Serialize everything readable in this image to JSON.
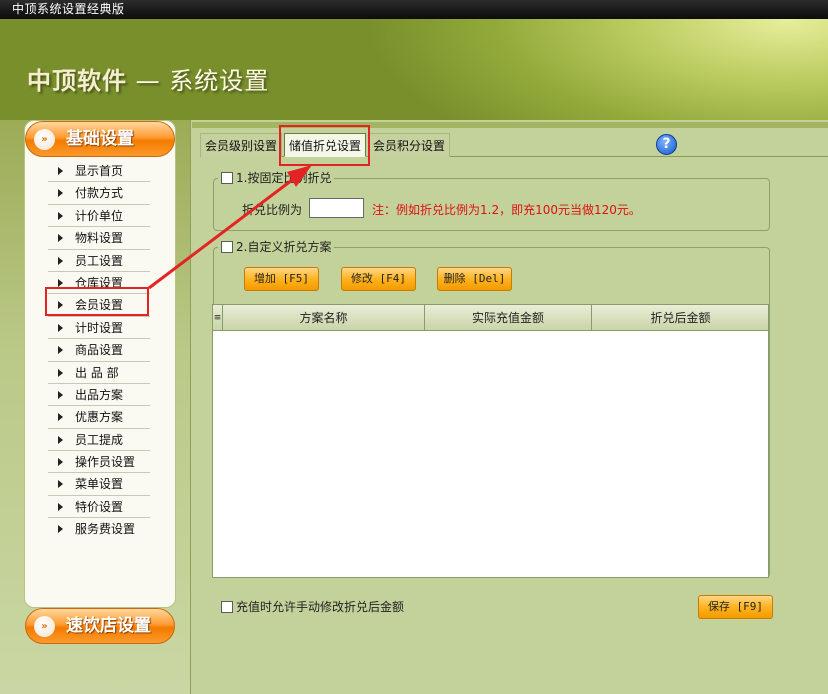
{
  "window": {
    "title": "中顶系统设置经典版"
  },
  "header": {
    "brand": "中顶软件",
    "subtitle": "— 系统设置"
  },
  "sidebar": {
    "section_top": "基础设置",
    "section_bottom": "速饮店设置",
    "items": [
      {
        "label": "显示首页"
      },
      {
        "label": "付款方式"
      },
      {
        "label": "计价单位"
      },
      {
        "label": "物料设置"
      },
      {
        "label": "员工设置"
      },
      {
        "label": "仓库设置"
      },
      {
        "label": "会员设置"
      },
      {
        "label": "计时设置"
      },
      {
        "label": "商品设置"
      },
      {
        "label": "出 品 部"
      },
      {
        "label": "出品方案"
      },
      {
        "label": "优惠方案"
      },
      {
        "label": "员工提成"
      },
      {
        "label": "操作员设置"
      },
      {
        "label": "菜单设置"
      },
      {
        "label": "特价设置"
      },
      {
        "label": "服务费设置"
      }
    ]
  },
  "tabs": [
    {
      "label": "会员级别设置"
    },
    {
      "label": "储值折兑设置"
    },
    {
      "label": "会员积分设置"
    }
  ],
  "help": "?",
  "section1": {
    "label": "1.按固定比例折兑",
    "ratio_label": "折兑比例为",
    "ratio_value": "",
    "note": "注：例如折兑比例为1.2，即充100元当做120元。"
  },
  "section2": {
    "label": "2.自定义折兑方案",
    "buttons": {
      "add": "增加 [F5]",
      "edit": "修改 [F4]",
      "del": "删除 [Del]"
    },
    "table": {
      "columns": [
        "方案名称",
        "实际充值金额",
        "折兑后金额"
      ],
      "rows": []
    }
  },
  "footer": {
    "checkbox_label": "充值时允许手动修改折兑后金额",
    "save": "保存 [F9]"
  },
  "colors": {
    "accent": "#f37b00",
    "highlight": "#e42424",
    "note": "#e01010"
  }
}
